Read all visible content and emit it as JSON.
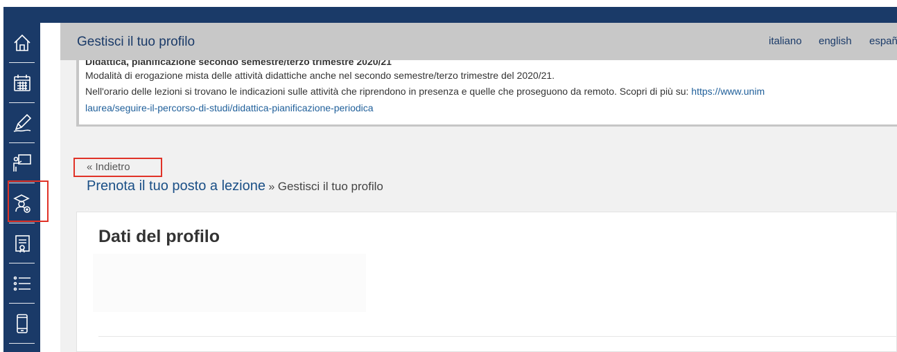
{
  "header": {
    "title": "Gestisci il tuo profilo",
    "languages": [
      "italiano",
      "english",
      "españ"
    ]
  },
  "sidebar": {
    "items": [
      {
        "icon": "home-icon"
      },
      {
        "icon": "calendar-icon"
      },
      {
        "icon": "pen-icon"
      },
      {
        "icon": "teacher-icon"
      },
      {
        "icon": "student-booking-icon",
        "highlighted": true
      },
      {
        "icon": "certificate-icon"
      },
      {
        "icon": "list-icon"
      },
      {
        "icon": "mobile-icon"
      }
    ]
  },
  "notice": {
    "title": "Didattica, pianificazione secondo semestre/terzo trimestre 2020/21",
    "line1": "Modalità di erogazione mista delle attività didattiche anche nel secondo semestre/terzo trimestre del 2020/21.",
    "line2": "Nell'orario delle lezioni si trovano le indicazioni sulle attività che riprendono in presenza e quelle che proseguono da remoto. Scopri di più su: ",
    "link_part1": "https://www.unim",
    "link_part2": "laurea/seguire-il-percorso-di-studi/didattica-pianificazione-periodica"
  },
  "navigation": {
    "back_label": "« Indietro",
    "breadcrumb_link": "Prenota il tuo posto a lezione",
    "breadcrumb_separator": " » ",
    "breadcrumb_current": "Gestisci il tuo profilo"
  },
  "profile": {
    "title": "Dati del profilo"
  },
  "colors": {
    "sidebar_bg": "#1a3a68",
    "header_bg": "#c8c8c8",
    "highlight": "#e03227",
    "link": "#1a4f86"
  }
}
